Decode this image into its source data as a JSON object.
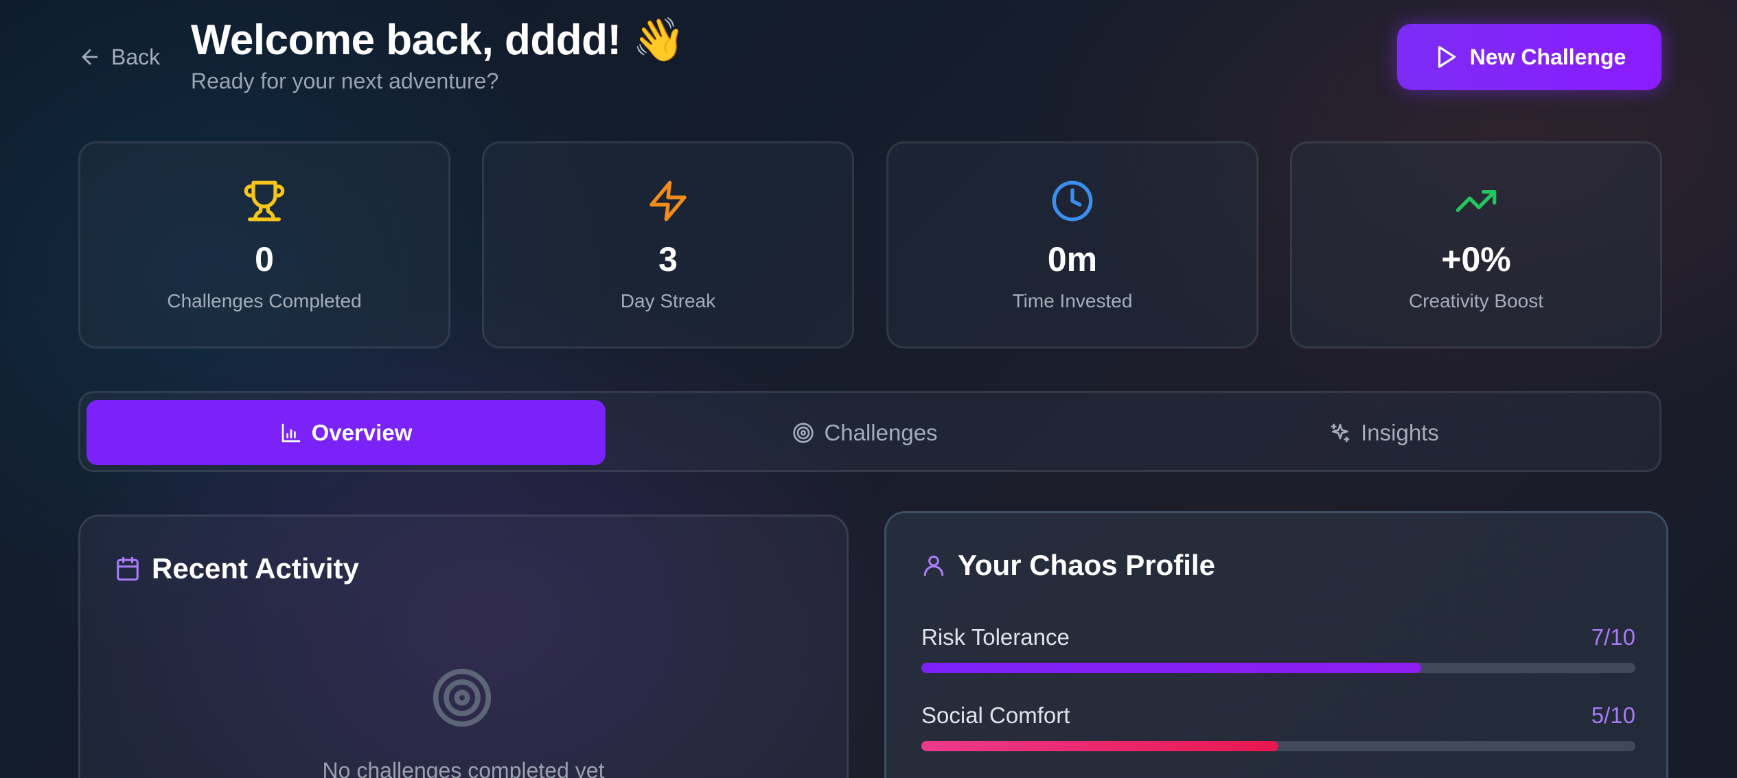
{
  "header": {
    "back_label": "Back",
    "title": "Welcome back, dddd! 👋",
    "subtitle": "Ready for your next adventure?",
    "new_challenge_label": "New Challenge"
  },
  "stats": [
    {
      "value": "0",
      "label": "Challenges Completed",
      "icon": "trophy-icon",
      "color": "#f5c518"
    },
    {
      "value": "3",
      "label": "Day Streak",
      "icon": "lightning-icon",
      "color": "#f28c1c"
    },
    {
      "value": "0m",
      "label": "Time Invested",
      "icon": "clock-icon",
      "color": "#3b8ff0"
    },
    {
      "value": "+0%",
      "label": "Creativity Boost",
      "icon": "trending-up-icon",
      "color": "#22c55e"
    }
  ],
  "tabs": [
    {
      "label": "Overview",
      "icon": "bar-chart-icon",
      "active": true
    },
    {
      "label": "Challenges",
      "icon": "target-icon",
      "active": false
    },
    {
      "label": "Insights",
      "icon": "sparkles-icon",
      "active": false
    }
  ],
  "recent_activity": {
    "title": "Recent Activity",
    "empty_text": "No challenges completed yet"
  },
  "chaos_profile": {
    "title": "Your Chaos Profile",
    "traits": [
      {
        "name": "Risk Tolerance",
        "score": "7/10",
        "fraction": 0.7,
        "color_from": "#7c22f8",
        "color_to": "#8e1df0"
      },
      {
        "name": "Social Comfort",
        "score": "5/10",
        "fraction": 0.5,
        "color_from": "#ec3a8c",
        "color_to": "#e8174f"
      }
    ]
  },
  "colors": {
    "accent": "#7a22f8",
    "score_text": "#a77bf5"
  }
}
